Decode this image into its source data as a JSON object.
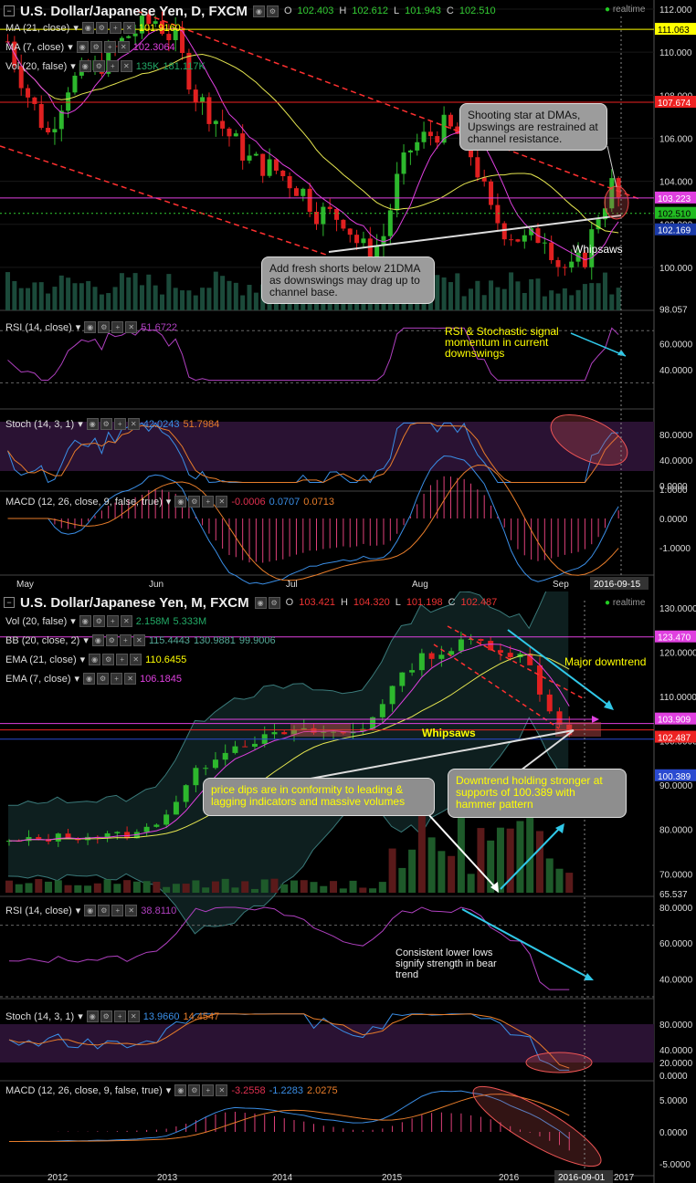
{
  "top": {
    "title": "U.S. Dollar/Japanese Yen, D, FXCM",
    "ohlc": {
      "o_label": "O",
      "o": "102.403",
      "h_label": "H",
      "h": "102.612",
      "l_label": "L",
      "l": "101.943",
      "c_label": "C",
      "c": "102.510"
    },
    "realtime": "realtime",
    "ind_ma21": "MA (21, close)",
    "ind_ma21_val": "101.9160",
    "ind_ma7": "MA (7, close)",
    "ind_ma7_val": "102.3064",
    "ind_vol": "Vol (20, false)",
    "ind_vol_v1": "135K",
    "ind_vol_v2": "181.117K",
    "y_ticks": [
      "112.000",
      "110.000",
      "108.000",
      "106.000",
      "104.000",
      "102.000",
      "100.000",
      "98.057"
    ],
    "price_labels": {
      "p1": "111.063",
      "p2": "107.674",
      "p3": "103.223",
      "p4": "102.510",
      "p5": "102.169"
    },
    "note1": "Shooting star at DMAs, Upswings are restrained at channel resistance.",
    "note2": "Add fresh shorts below 21DMA as downswings may drag up to channel base.",
    "whipsaws": "Whipsaws",
    "rsi_label": "RSI (14, close)",
    "rsi_val": "51.6722",
    "rsi_ticks": [
      "60.0000",
      "40.0000"
    ],
    "rsi_note": "RSI & Stochastic signal momentum in current downswings",
    "stoch_label": "Stoch (14, 3, 1)",
    "stoch_v1": "42.0243",
    "stoch_v2": "51.7984",
    "stoch_ticks": [
      "80.0000",
      "40.0000",
      "0.0000"
    ],
    "macd_label": "MACD (12, 26, close, 9, false, true)",
    "macd_v1": "-0.0006",
    "macd_v2": "0.0707",
    "macd_v3": "0.0713",
    "macd_ticks": [
      "1.0000",
      "0.0000",
      "-1.0000"
    ],
    "x_labels": [
      "May",
      "Jun",
      "Jul",
      "Aug",
      "Sep"
    ],
    "date_badge": "2016-09-15"
  },
  "bottom": {
    "title": "U.S. Dollar/Japanese Yen, M, FXCM",
    "ohlc": {
      "o_label": "O",
      "o": "103.421",
      "h_label": "H",
      "h": "104.320",
      "l_label": "L",
      "l": "101.198",
      "c_label": "C",
      "c": "102.487"
    },
    "realtime": "realtime",
    "ind_vol": "Vol (20, false)",
    "ind_vol_v1": "2.158M",
    "ind_vol_v2": "5.333M",
    "ind_bb": "BB (20, close, 2)",
    "ind_bb_v1": "115.4443",
    "ind_bb_v2": "130.9881",
    "ind_bb_v3": "99.9006",
    "ind_ema21": "EMA (21, close)",
    "ind_ema21_val": "110.6455",
    "ind_ema7": "EMA (7, close)",
    "ind_ema7_val": "106.1845",
    "y_ticks": [
      "130.0000",
      "120.0000",
      "110.0000",
      "100.0000",
      "90.0000",
      "80.0000",
      "70.0000",
      "65.537"
    ],
    "price_labels": {
      "p1": "123.470",
      "p2": "103.909",
      "p3": "102.487",
      "p4": "100.389"
    },
    "major_downtrend": "Major downtrend",
    "whipsaws": "Whipsaws",
    "note1": "price dips are in conformity to leading & lagging indicators and massive volumes",
    "note2": "Downtrend holding stronger at supports of 100.389 with hammer pattern",
    "rsi_label": "RSI (14, close)",
    "rsi_val": "38.8110",
    "rsi_ticks": [
      "80.0000",
      "60.0000",
      "40.0000"
    ],
    "rsi_note": "Consistent lower lows signify strength in bear trend",
    "stoch_label": "Stoch (14, 3, 1)",
    "stoch_v1": "13.9660",
    "stoch_v2": "14.4547",
    "stoch_ticks": [
      "80.0000",
      "40.0000",
      "20.0000",
      "0.0000"
    ],
    "macd_label": "MACD (12, 26, close, 9, false, true)",
    "macd_v1": "-3.2558",
    "macd_v2": "-1.2283",
    "macd_v3": "2.0275",
    "macd_ticks": [
      "5.0000",
      "0.0000",
      "-5.0000"
    ],
    "x_labels": [
      "2012",
      "2013",
      "2014",
      "2015",
      "2016",
      "2017"
    ],
    "date_badge": "2016-09-01"
  },
  "colors": {
    "up": "#2db82d",
    "down": "#e02020",
    "ma21": "#e6e650",
    "ma7": "#e040e0",
    "rsi": "#b040c0",
    "stoch_k": "#3a8ee6",
    "stoch_d": "#e87d2a",
    "trend": "#ff3030",
    "note_arrow": "#30c8e8"
  },
  "chart_data": [
    {
      "type": "line",
      "title": "U.S. Dollar/Japanese Yen, D, FXCM",
      "x": [
        "May",
        "Jun",
        "Jul",
        "Aug",
        "Sep"
      ],
      "ylim": [
        98.057,
        112
      ],
      "series": [
        {
          "name": "MA (21, close)",
          "values": [
            108.5,
            107.0,
            104.0,
            101.8,
            101.9
          ]
        },
        {
          "name": "MA (7, close)",
          "values": [
            107.0,
            108.5,
            102.0,
            101.5,
            102.3
          ]
        }
      ]
    },
    {
      "type": "line",
      "title": "U.S. Dollar/Japanese Yen, M, FXCM",
      "x": [
        "2012",
        "2013",
        "2014",
        "2015",
        "2016",
        "2017"
      ],
      "ylim": [
        65.537,
        130
      ],
      "series": [
        {
          "name": "EMA (21, close)",
          "values": [
            79,
            85,
            100,
            112,
            115,
            110.6
          ]
        },
        {
          "name": "EMA (7, close)",
          "values": [
            78,
            92,
            103,
            119,
            117,
            106.2
          ]
        }
      ]
    }
  ]
}
